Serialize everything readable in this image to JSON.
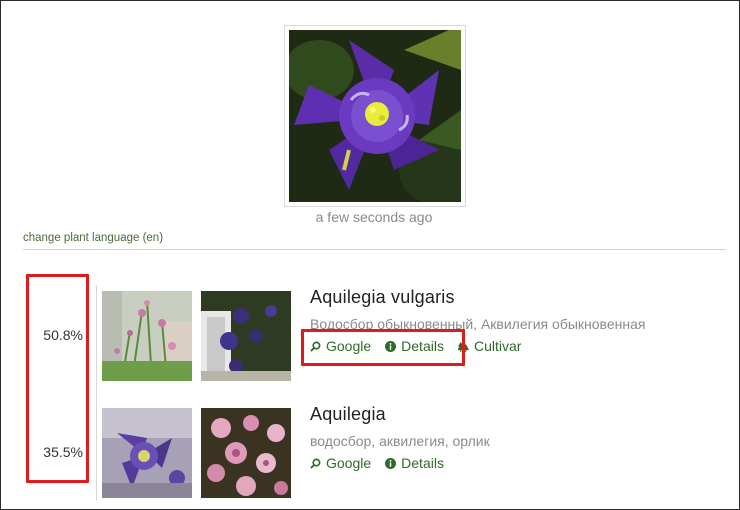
{
  "upload": {
    "timestamp": "a few seconds ago"
  },
  "language_link": "change plant language (en)",
  "results": [
    {
      "score": "50.8%",
      "name": "Aquilegia vulgaris",
      "common_names": "Водосбор обыкновенный, Аквилегия обыкновенная",
      "links": {
        "google": "Google",
        "details": "Details",
        "cultivar": "Cultivar"
      }
    },
    {
      "score": "35.5%",
      "name": "Aquilegia",
      "common_names": "водосбор, аквилегия, орлик",
      "links": {
        "google": "Google",
        "details": "Details"
      }
    }
  ],
  "colors": {
    "link": "#2e6b2a",
    "highlight": "#e01b1b",
    "muted": "#8a8a8a"
  },
  "icons": {
    "google": "magnifier-icon",
    "details": "info-circle-icon",
    "cultivar": "tree-icon"
  }
}
